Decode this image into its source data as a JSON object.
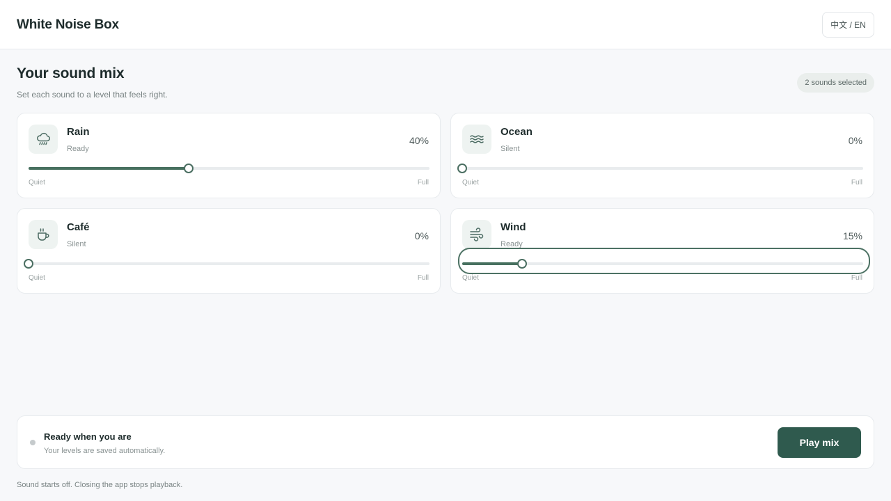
{
  "header": {
    "title": "White Noise Box",
    "language_toggle": "中文 / EN"
  },
  "mix": {
    "title": "Your sound mix",
    "subtitle": "Set each sound to a level that feels right.",
    "selected_badge": "2 sounds selected",
    "range_min_label": "Quiet",
    "range_max_label": "Full"
  },
  "sounds": [
    {
      "name": "Rain",
      "status": "Ready",
      "level_text": "40%",
      "level": 40,
      "icon": "rain-cloud-icon"
    },
    {
      "name": "Ocean",
      "status": "Silent",
      "level_text": "0%",
      "level": 0,
      "icon": "waves-icon"
    },
    {
      "name": "Café",
      "status": "Silent",
      "level_text": "0%",
      "level": 0,
      "icon": "coffee-cup-icon"
    },
    {
      "name": "Wind",
      "status": "Ready",
      "level_text": "15%",
      "level": 15,
      "icon": "wind-icon"
    }
  ],
  "player": {
    "status_title": "Ready when you are",
    "status_subtitle": "Your levels are saved automatically.",
    "play_label": "Play mix"
  },
  "footnote": "Sound starts off. Closing the app stops playback.",
  "colors": {
    "accent": "#2f5a4e",
    "slider_fill": "#47705f",
    "background": "#f7f8fa"
  }
}
